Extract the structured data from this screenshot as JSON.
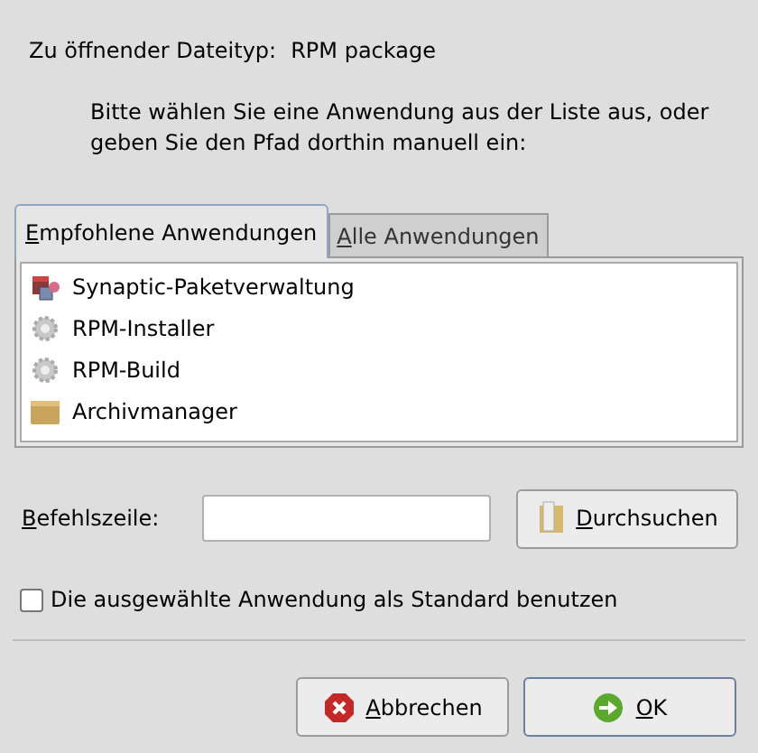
{
  "file_type": {
    "label": "Zu öffnender Dateityp:",
    "value": "RPM package"
  },
  "instruction": "Bitte wählen Sie eine Anwendung aus der Liste aus, oder geben Sie den Pfad dorthin manuell ein:",
  "tabs": [
    {
      "label": "Empfohlene Anwendungen",
      "selected": true,
      "mnemonic": true
    },
    {
      "label": "Alle Anwendungen",
      "selected": false,
      "mnemonic": true
    }
  ],
  "applications": [
    {
      "name": "Synaptic-Paketverwaltung",
      "kind": "package",
      "selected": false
    },
    {
      "name": "RPM-Installer",
      "kind": "gear",
      "selected": false
    },
    {
      "name": "RPM-Build",
      "kind": "gear",
      "selected": false
    },
    {
      "name": "Archivmanager",
      "kind": "archive",
      "selected": false
    }
  ],
  "command": {
    "label": "Befehlszeile:",
    "mnemonic": true,
    "browse": {
      "label": "Durchsuchen",
      "mnemonic": true
    }
  },
  "default_checkbox": {
    "label": "Die ausgewählte Anwendung als Standard benutzen",
    "checked": false
  },
  "buttons": [
    {
      "label": "Abbrechen",
      "kind": "cancel",
      "mnemonic": true
    },
    {
      "label": "OK",
      "kind": "ok",
      "mnemonic": true
    }
  ]
}
